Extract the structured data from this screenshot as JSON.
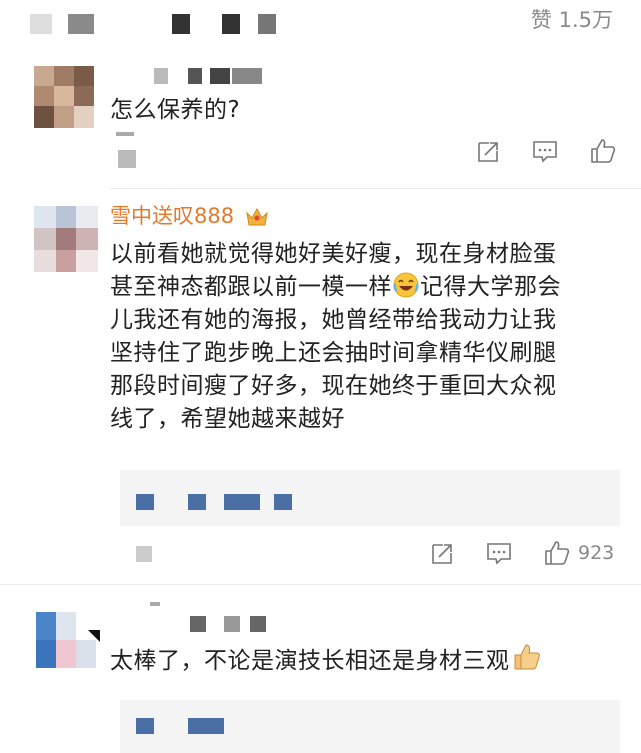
{
  "top": {
    "like_label": "赞",
    "like_count": "1.5万"
  },
  "comments": [
    {
      "text": "怎么保养的?"
    },
    {
      "username": "雪中送叹888",
      "lines": [
        "以前看她就觉得她好美好瘦，现在身材脸蛋",
        "甚至神态都跟以前一模一样",
        "记得大学那会",
        "儿我还有她的海报，她曾经带给我动力让我",
        "坚持住了跑步晚上还会抽时间拿精华仪刷腿",
        "那段时间瘦了好多，现在她终于重回大众视",
        "线了，希望她越来越好"
      ],
      "like_count": "923"
    },
    {
      "text": "太棒了，不论是演技长相还是身材三观"
    }
  ],
  "icons": {
    "forward": "share-icon",
    "comment": "comment-icon",
    "like": "thumbs-up-icon",
    "vip": "crown-icon",
    "laugh": "laughing-emoji-icon",
    "thumb_emoji": "thumbs-up-emoji-icon"
  },
  "colors": {
    "username": "#e07b2c",
    "mosaic_blue": "#4a6fa5",
    "mosaic_dark": "#333333"
  }
}
